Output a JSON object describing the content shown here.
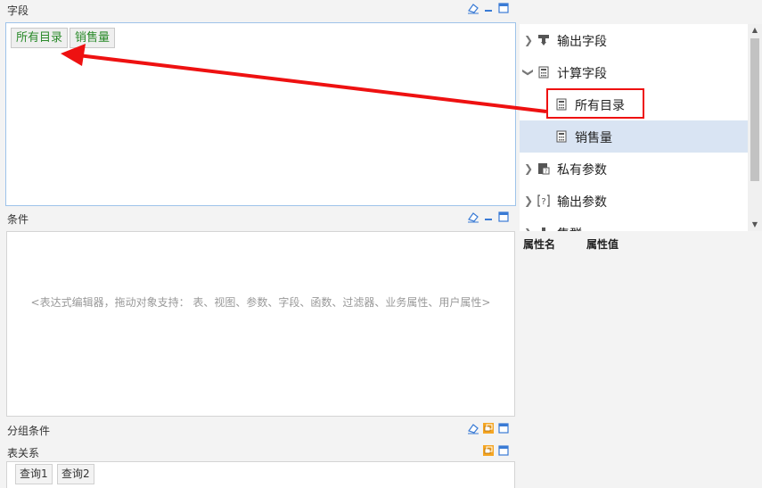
{
  "fields_section": {
    "title": "字段",
    "chips": [
      "所有目录",
      "销售量"
    ]
  },
  "conditions_section": {
    "title": "条件",
    "placeholder": "<表达式编辑器，拖动对象支持： 表、视图、参数、字段、函数、过滤器、业务属性、用户属性>"
  },
  "group_section": {
    "title": "分组条件"
  },
  "relation_section": {
    "title": "表关系",
    "tabs": [
      "查询1",
      "查询2"
    ]
  },
  "tree": {
    "items": [
      {
        "label": "输出字段",
        "icon": "output-field-icon",
        "expander": "collapsed"
      },
      {
        "label": "计算字段",
        "icon": "calculator-icon",
        "expander": "expanded"
      },
      {
        "label": "所有目录",
        "icon": "calculator-icon",
        "highlighted": true
      },
      {
        "label": "销售量",
        "icon": "calculator-icon",
        "selected": true
      },
      {
        "label": "私有参数",
        "icon": "private-param-icon",
        "expander": "collapsed"
      },
      {
        "label": "输出参数",
        "icon": "output-param-icon",
        "expander": "collapsed"
      },
      {
        "label": "集群",
        "icon": "cluster-icon",
        "expander": "collapsed"
      }
    ]
  },
  "properties": {
    "col_name": "属性名",
    "col_value": "属性值"
  },
  "colors": {
    "accent_border": "#9ec3ea",
    "chip_text": "#2a8a2a",
    "selected_row": "#d9e4f3",
    "annotation_red": "#e11"
  }
}
